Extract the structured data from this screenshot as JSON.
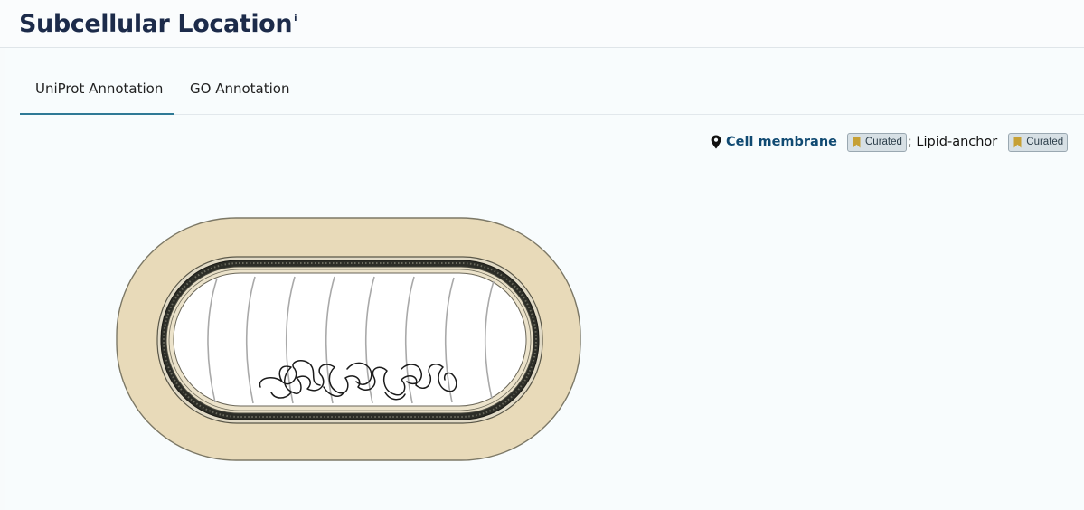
{
  "header": {
    "title": "Subcellular Location",
    "info_marker": "i"
  },
  "tabs": [
    {
      "label": "UniProt Annotation",
      "active": true
    },
    {
      "label": "GO Annotation",
      "active": false
    }
  ],
  "location": {
    "icon": "map-pin-icon",
    "name": "Cell membrane",
    "evidence_1": "Curated",
    "separator_text": "; Lipid-anchor",
    "evidence_2": "Curated"
  },
  "colors": {
    "title": "#1c2b4a",
    "link": "#104a72",
    "tab_underline": "#2f7a96",
    "cell_wall": "#e8dab9",
    "badge_bookmark": "#c6a035"
  },
  "diagram": {
    "icon": "bacterial-cell-diagram"
  }
}
